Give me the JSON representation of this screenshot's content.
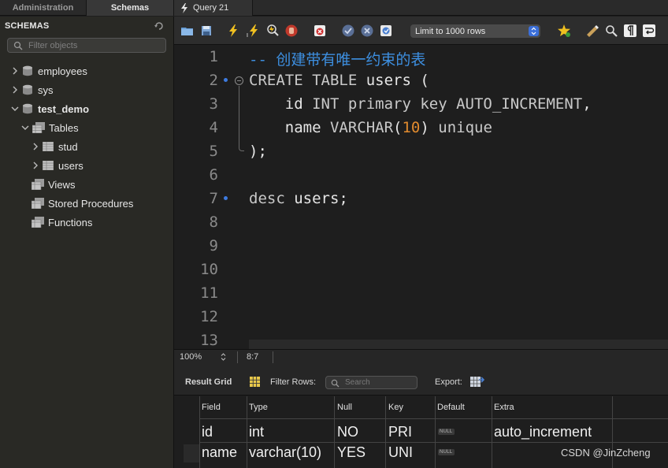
{
  "tabs": {
    "administration": "Administration",
    "schemas": "Schemas",
    "query": "Query 21"
  },
  "sidebar": {
    "title": "SCHEMAS",
    "filter_placeholder": "Filter objects",
    "schemas": [
      {
        "name": "employees",
        "expanded": false
      },
      {
        "name": "sys",
        "expanded": false
      },
      {
        "name": "test_demo",
        "expanded": true
      }
    ],
    "groups": {
      "tables": "Tables",
      "views": "Views",
      "procedures": "Stored Procedures",
      "functions": "Functions"
    },
    "tables": [
      "stud",
      "users"
    ]
  },
  "toolbar": {
    "limit_label": "Limit to 1000 rows",
    "icons": [
      "open-folder-icon",
      "save-icon",
      "execute-icon",
      "execute-current-icon",
      "explain-icon",
      "stop-icon",
      "toggle-error-icon",
      "commit-icon",
      "rollback-icon",
      "autocommit-icon",
      "bookmark-icon",
      "beautify-icon",
      "find-icon",
      "invisible-chars-icon",
      "wrap-icon"
    ]
  },
  "editor": {
    "line_numbers": [
      "1",
      "2",
      "3",
      "4",
      "5",
      "6",
      "7",
      "8",
      "9",
      "10",
      "11",
      "12",
      "13"
    ],
    "comment": "-- 创建带有唯一约束的表",
    "line2_kw": "CREATE TABLE",
    "line2_rest": " users (",
    "line3_a": "    id ",
    "line3_kw": "INT primary key AUTO_INCREMENT",
    "line3_b": ",",
    "line4_a": "    name ",
    "line4_kw": "VARCHAR",
    "line4_b": "(",
    "line4_num": "10",
    "line4_c": ") ",
    "line4_kw2": "unique",
    "line5": ");",
    "line7_kw": "desc",
    "line7_rest": " users;"
  },
  "status": {
    "zoom": "100%",
    "cursor": "8:7"
  },
  "result": {
    "title": "Result Grid",
    "filter_label": "Filter Rows:",
    "search_placeholder": "Search",
    "export_label": "Export:",
    "columns": [
      "Field",
      "Type",
      "Null",
      "Key",
      "Default",
      "Extra"
    ],
    "rows": [
      {
        "field": "id",
        "type": "int",
        "null": "NO",
        "key": "PRI",
        "default": "NULL",
        "extra": "auto_increment"
      },
      {
        "field": "name",
        "type": "varchar(10)",
        "null": "YES",
        "key": "UNI",
        "default": "NULL",
        "extra": ""
      }
    ]
  },
  "watermark": "CSDN @JinZcheng"
}
